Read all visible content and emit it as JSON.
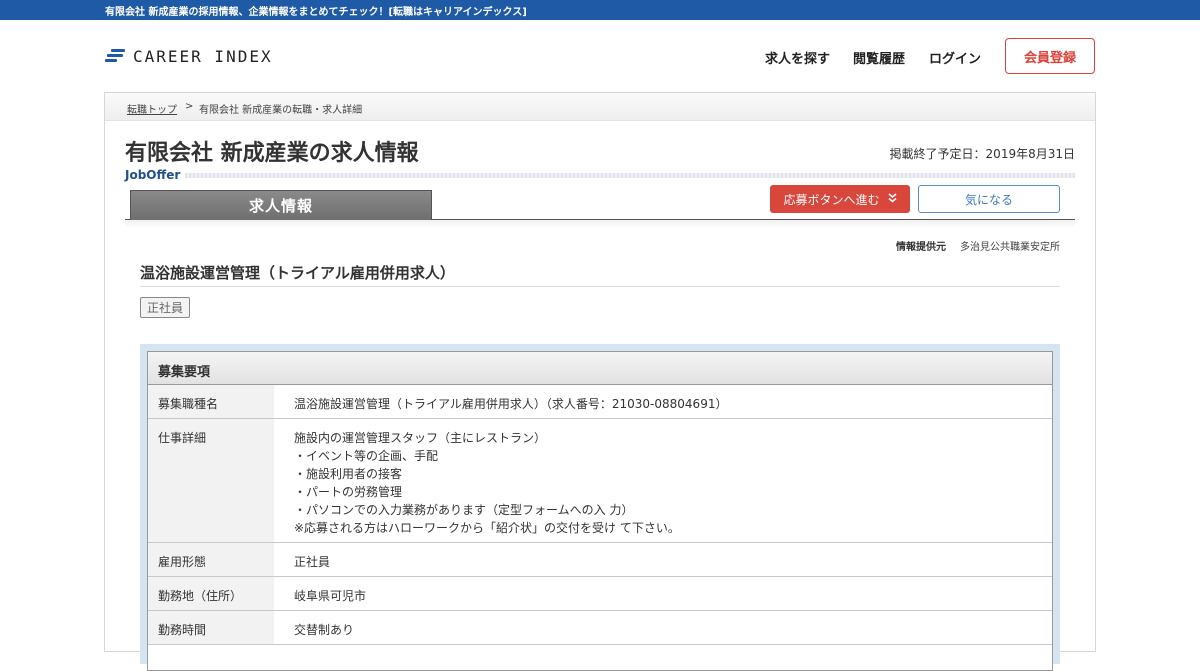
{
  "topbar": {
    "text": "有限会社 新成産業の採用情報、企業情報をまとめてチェック！[転職はキャリアインデックス]"
  },
  "header": {
    "logo_text": "CAREER INDEX",
    "nav": [
      "求人を探す",
      "閲覧履歴",
      "ログイン"
    ],
    "register_label": "会員登録"
  },
  "breadcrumb": {
    "home": "転職トップ",
    "separator": ">",
    "current": "有限会社 新成産業の転職・求人詳細"
  },
  "page": {
    "title": "有限会社 新成産業の求人情報",
    "end_date": "掲載終了予定日：2019年8月31日",
    "joboffer": "JobOffer",
    "tab_label": "求人情報",
    "apply_label": "応募ボタンへ進む",
    "favorite_label": "気になる",
    "source_label": "情報提供元",
    "source_value": "多治見公共職業安定所",
    "job_title": "温浴施設運営管理（トライアル雇用併用求人）",
    "employment_badge": "正社員"
  },
  "details": {
    "heading": "募集要項",
    "rows": [
      {
        "label": "募集職種名",
        "value": "温浴施設運営管理（トライアル雇用併用求人）（求人番号：21030-08804691）"
      },
      {
        "label": "仕事詳細",
        "lines": [
          "施設内の運営管理スタッフ（主にレストラン）",
          "・イベント等の企画、手配",
          "・施設利用者の接客",
          "・パートの労務管理",
          "・パソコンでの入力業務があります（定型フォームへの入 力）",
          "※応募される方はハローワークから「紹介状」の交付を受け て下さい。"
        ]
      },
      {
        "label": "雇用形態",
        "value": "正社員"
      },
      {
        "label": "勤務地（住所）",
        "value": "岐阜県可児市"
      },
      {
        "label": "勤務時間",
        "value": "交替制あり"
      }
    ]
  },
  "colors": {
    "brand_blue": "#1f5aa7",
    "accent_red": "#d9463b",
    "link_blue": "#3a78c8"
  },
  "icons": {
    "apply_chevron": "double-chevron-down-icon",
    "logo_mark": "logo-lines-icon"
  }
}
